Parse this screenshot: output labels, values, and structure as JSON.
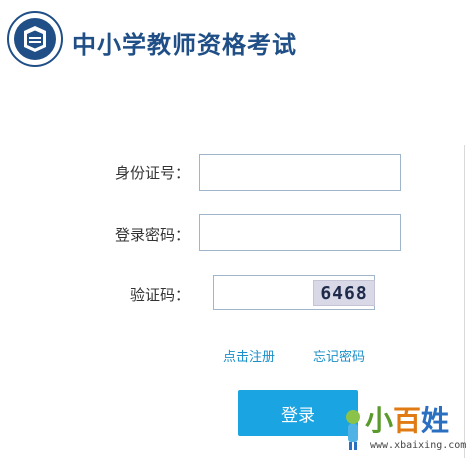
{
  "header": {
    "title": "中小学教师资格考试"
  },
  "form": {
    "id_label": "身份证号：",
    "password_label": "登录密码：",
    "captcha_label": "验证码：",
    "id_value": "",
    "password_value": "",
    "captcha_value": "",
    "captcha_text": "6468"
  },
  "links": {
    "register": "点击注册",
    "forgot": "忘记密码"
  },
  "actions": {
    "login": "登录"
  },
  "watermark": {
    "brand_1": "小",
    "brand_2": "百",
    "brand_3": "姓",
    "url": "www.xbaixing.com"
  },
  "colors": {
    "brand_blue": "#1f4f86",
    "button_blue": "#1aa4e2",
    "link_blue": "#1a8fc9"
  }
}
